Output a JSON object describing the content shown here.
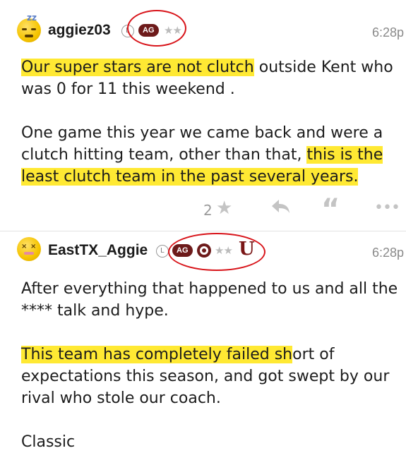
{
  "posts": [
    {
      "username": "aggiez03",
      "badge_l": "L",
      "badge_ag": "AG",
      "stars": "★★",
      "time": "6:28p",
      "paragraphs": [
        {
          "highlighted": "Our super stars are not clutch",
          "rest": " outside Kent who was 0 for 11 this weekend ."
        },
        {
          "lead": "One game this year we came back and were a clutch hitting team, other than that, ",
          "highlighted": "this is the least clutch team in the past several years."
        }
      ]
    },
    {
      "username": "EastTX_Aggie",
      "badge_l": "L",
      "badge_ag": "AG",
      "stars": "★★",
      "time": "6:28p",
      "paragraphs": [
        {
          "text": "After everything that happened to us and all the **** talk and hype."
        },
        {
          "highlighted": "This team has completely failed sh",
          "rest": "ort of expectations this season, and got swept by our rival who stole our coach."
        },
        {
          "text": "Classic"
        }
      ]
    }
  ],
  "actions": {
    "like_count": "2",
    "star_icon": "star-icon",
    "reply_icon": "reply-icon",
    "quote_icon": "quote-icon",
    "more_icon": "more-icon"
  }
}
